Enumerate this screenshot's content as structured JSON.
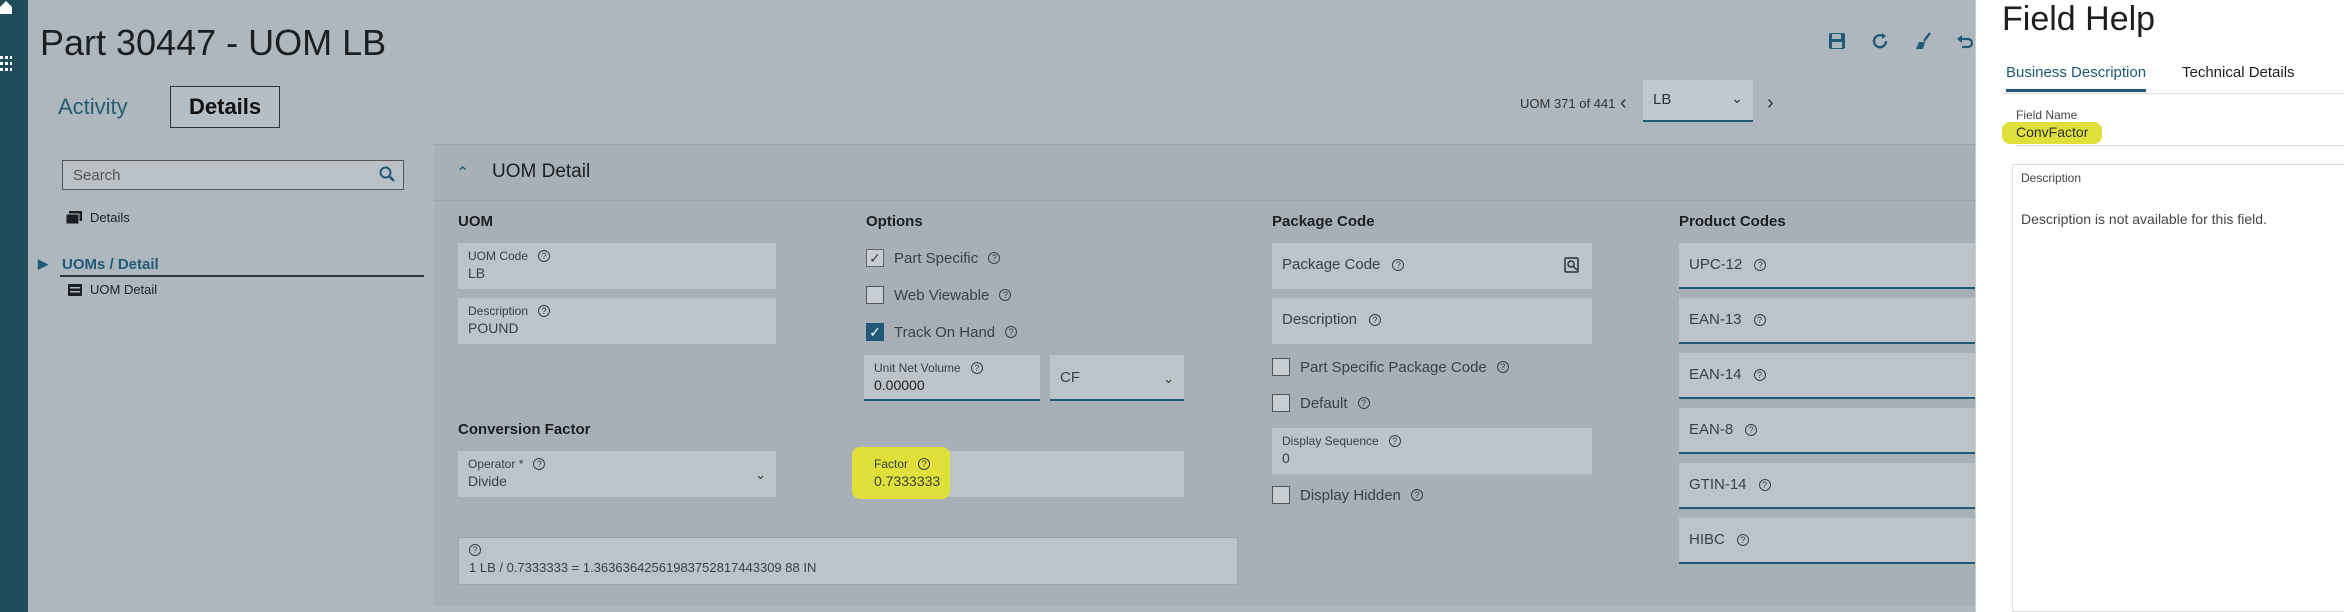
{
  "header": {
    "title": "Part 30447 - UOM LB",
    "tabs": [
      {
        "label": "Activity"
      },
      {
        "label": "Details"
      }
    ],
    "pager_text": "UOM 371 of 441",
    "uom_select": "LB"
  },
  "leftnav": {
    "search_placeholder": "Search",
    "details_label": "Details",
    "uoms_label": "UOMs / Detail",
    "uom_detail_label": "UOM Detail"
  },
  "section": {
    "title": "UOM Detail"
  },
  "uom_group": {
    "title": "UOM",
    "uom_code_label": "UOM Code",
    "uom_code_value": "LB",
    "description_label": "Description",
    "description_value": "POUND"
  },
  "options_group": {
    "title": "Options",
    "part_specific": "Part Specific",
    "web_viewable": "Web Viewable",
    "track_on_hand": "Track On Hand",
    "unit_net_volume_label": "Unit Net Volume",
    "unit_net_volume_value": "0.00000",
    "volume_uom": "CF"
  },
  "conversion_group": {
    "title": "Conversion Factor",
    "operator_label": "Operator *",
    "operator_value": "Divide",
    "factor_label": "Factor",
    "factor_value": "0.7333333",
    "formula": "1 LB / 0.7333333 = 1.36363642561983752817443309 88 IN"
  },
  "package_group": {
    "title": "Package Code",
    "package_code": "Package Code",
    "description": "Description",
    "part_specific_package_code": "Part Specific Package Code",
    "default": "Default",
    "display_sequence_label": "Display Sequence",
    "display_sequence_value": "0",
    "display_hidden": "Display Hidden"
  },
  "product_codes": {
    "title": "Product Codes",
    "items": [
      "UPC-12",
      "EAN-13",
      "EAN-14",
      "EAN-8",
      "GTIN-14",
      "HIBC"
    ]
  },
  "field_help": {
    "title": "Field Help",
    "tabs": [
      "Business Description",
      "Technical Details"
    ],
    "field_name_label": "Field Name",
    "field_name_value": "ConvFactor",
    "description_label": "Description",
    "description_text": "Description is not available for this field."
  },
  "colors": {
    "accent": "#1f5a78",
    "highlight": "#e0e03a",
    "rail": "#1f4e5a"
  }
}
